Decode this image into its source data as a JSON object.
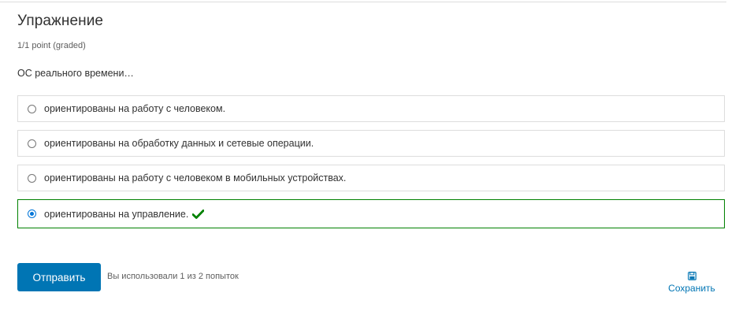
{
  "problem": {
    "title": "Упражнение",
    "points": "1/1 point (graded)",
    "question": "ОС реального времени…"
  },
  "options": [
    {
      "label": "ориентированы на работу с человеком.",
      "selected": false
    },
    {
      "label": "ориентированы на обработку данных и сетевые операции.",
      "selected": false
    },
    {
      "label": "ориентированы на работу с человеком в мобильных устройствах.",
      "selected": false
    },
    {
      "label": "ориентированы на управление.",
      "selected": true,
      "status": "correct"
    }
  ],
  "actions": {
    "submit_label": "Отправить",
    "attempts_text": "Вы использовали 1 из 2 попыток",
    "save_label": "Сохранить"
  },
  "colors": {
    "accent": "#0075b4",
    "correct": "#008100",
    "radio_selected": "#0075d8"
  },
  "icons": {
    "correct": "check-icon",
    "save": "floppy-disk-icon"
  }
}
